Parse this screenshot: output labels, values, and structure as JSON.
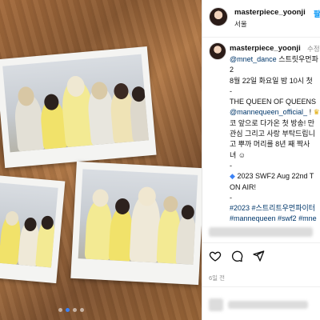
{
  "post": {
    "username": "masterpiece_yoonji",
    "follow_label": "팔로",
    "location": "서울",
    "edited_label": "수정됨",
    "caption_lines": [
      "@mnet_dance 스트릿우먼파",
      "2",
      "8월 22일 화요일 밤 10시 첫",
      "-",
      "THE QUEEN OF QUEENS",
      "@mannequeen_official_ !",
      "코 앞으로 다가온 첫 방송! 만",
      "관심 그리고 사랑 부탁드립니",
      "고 뿌까 머리를 8년 째 짝사",
      "녀",
      "-",
      "2023 SWF2 Aug 22nd T",
      "ON AIR!",
      "-",
      "#2023 #스트리트우먼파이터",
      "#mannequeen #swf2 #mne"
    ],
    "time_ago": "6일 전",
    "carousel": {
      "count": 4,
      "active_index": 1
    }
  },
  "icons": [
    "like-icon",
    "comment-icon",
    "share-icon"
  ],
  "colors": {
    "link": "#00376b",
    "follow": "#0095f6",
    "active_dot": "#3b82f6"
  }
}
